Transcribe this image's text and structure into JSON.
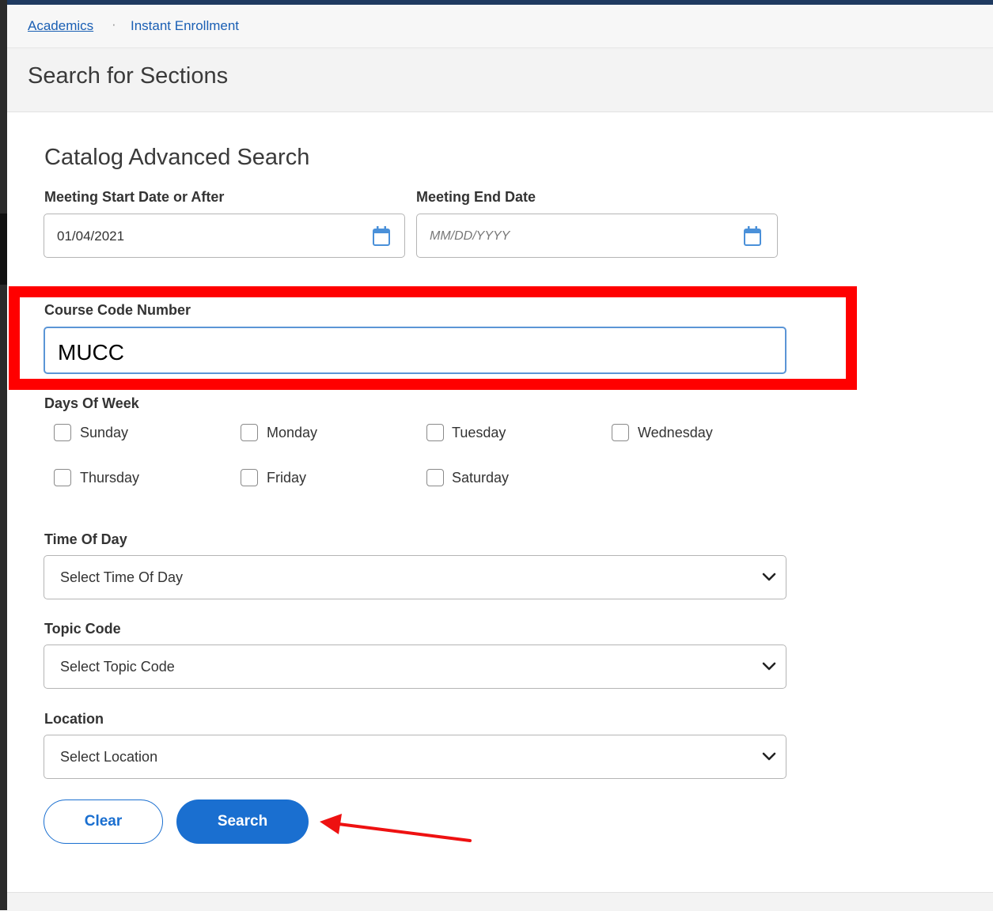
{
  "breadcrumb": {
    "root": "Academics",
    "separator": "·",
    "current": "Instant Enrollment"
  },
  "page_title": "Search for Sections",
  "section_heading": "Catalog Advanced Search",
  "fields": {
    "start_date": {
      "label": "Meeting Start Date or After",
      "value": "01/04/2021",
      "icon": "calendar-icon"
    },
    "end_date": {
      "label": "Meeting End Date",
      "placeholder": "MM/DD/YYYY",
      "icon": "calendar-icon"
    },
    "course_code": {
      "label": "Course Code Number",
      "value": "MUCC"
    },
    "days_of_week": {
      "label": "Days Of Week",
      "days": [
        "Sunday",
        "Monday",
        "Tuesday",
        "Wednesday",
        "Thursday",
        "Friday",
        "Saturday"
      ]
    },
    "time_of_day": {
      "label": "Time Of Day",
      "selected": "Select Time Of Day"
    },
    "topic_code": {
      "label": "Topic Code",
      "selected": "Select Topic Code"
    },
    "location": {
      "label": "Location",
      "selected": "Select Location"
    }
  },
  "buttons": {
    "clear": "Clear",
    "search": "Search"
  },
  "colors": {
    "link": "#1a5fb4",
    "primary": "#1a6fd0",
    "annotation": "#ff0000",
    "focus_border": "#5b95d6"
  }
}
